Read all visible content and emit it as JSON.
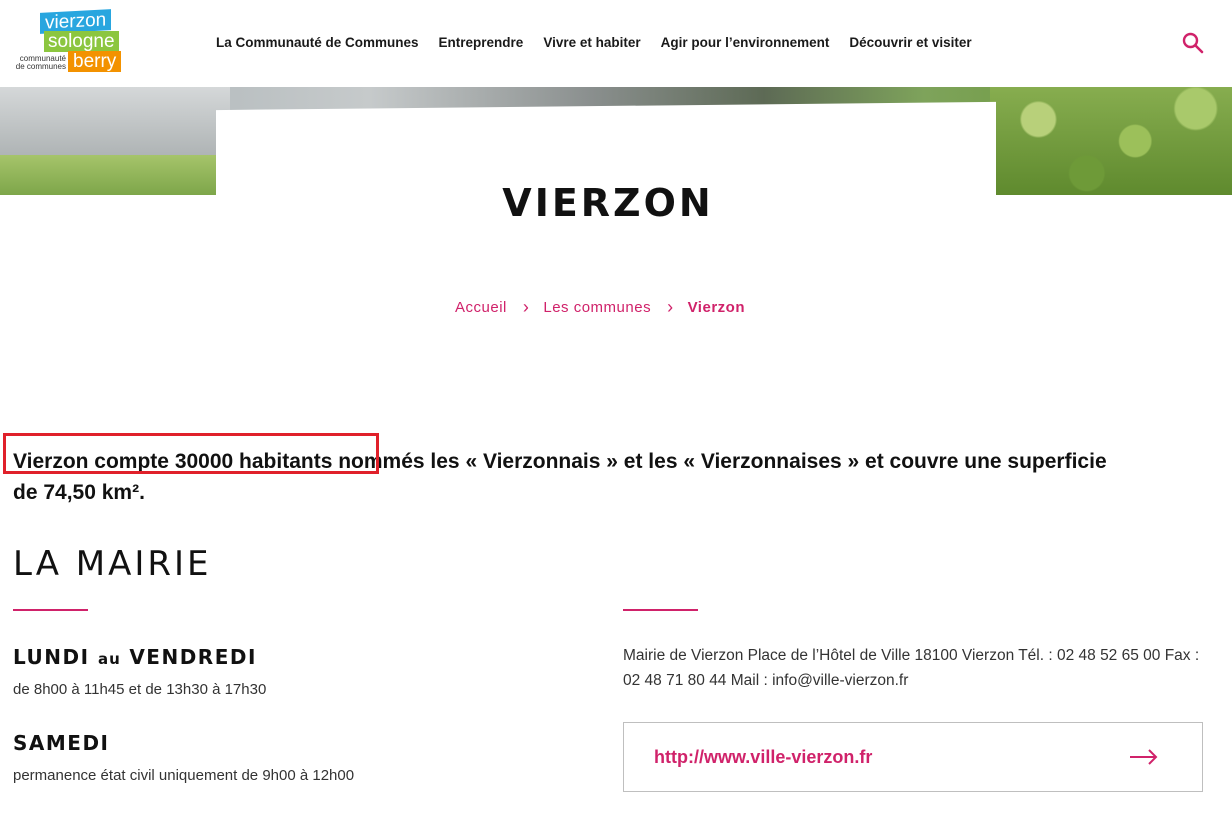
{
  "logo": {
    "word1": "vierzon",
    "word2": "sologne",
    "word3": "berry",
    "tagline": "communauté de communes"
  },
  "nav": {
    "items": [
      "La Communauté de Communes",
      "Entreprendre",
      "Vivre et habiter",
      "Agir pour l’environnement",
      "Découvrir et visiter"
    ],
    "search_icon": "search-icon"
  },
  "page": {
    "title": "VIERZON"
  },
  "breadcrumb": {
    "items": [
      "Accueil",
      "Les communes"
    ],
    "current": "Vierzon",
    "separator": "›"
  },
  "intro": {
    "text": "Vierzon compte 30000 habitants nommés les « Vierzonnais » et les « Vierzonnaises » et couvre une superficie de 74,50 km²."
  },
  "mairie": {
    "title": "LA MAIRIE",
    "schedule": [
      {
        "day_start": "LUNDI",
        "connector": "au",
        "day_end": "VENDREDI",
        "hours": "de 8h00 à 11h45 et de 13h30 à 17h30"
      },
      {
        "day_start": "SAMEDI",
        "hours": "permanence état civil uniquement de 9h00 à 12h00"
      }
    ],
    "address": "Mairie de Vierzon Place de l’Hôtel de Ville 18100 Vierzon Tél. : 02 48 52 65 00 Fax : 02 48 71 80 44 Mail : info@ville-vierzon.fr",
    "website": "http://www.ville-vierzon.fr"
  },
  "colors": {
    "accent": "#d0226a",
    "highlight": "#e0202a"
  }
}
